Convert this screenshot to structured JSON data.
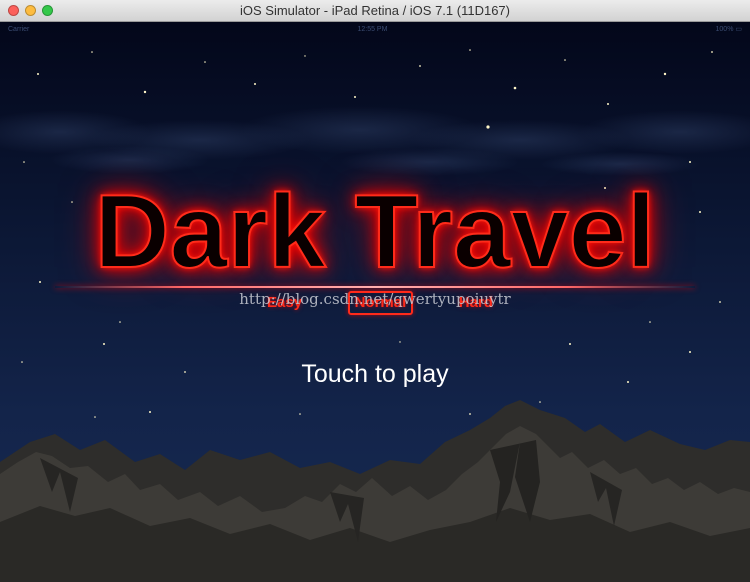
{
  "window": {
    "title": "iOS Simulator - iPad Retina / iOS 7.1 (11D167)"
  },
  "statusbar": {
    "carrier": "Carrier",
    "time": "12:55 PM",
    "battery": "100%"
  },
  "game": {
    "title": "Dark Travel",
    "difficulty": [
      {
        "label": "Easy",
        "selected": false
      },
      {
        "label": "Normal",
        "selected": true
      },
      {
        "label": "Hard",
        "selected": false
      }
    ],
    "prompt": "Touch to play"
  },
  "watermark": "http://blog.csdn.net/qwertyupoiuytr",
  "colors": {
    "title_glow": "#ff1a0a",
    "difficulty_text": "#ff2a1a",
    "sky_top": "#03071a",
    "sky_bottom": "#172a52",
    "mountain": "#3a3834"
  },
  "icons": [
    "close-icon",
    "minimize-icon",
    "zoom-icon",
    "battery-icon"
  ]
}
